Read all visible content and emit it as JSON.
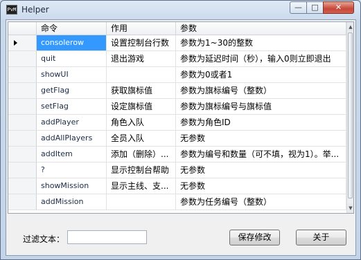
{
  "window": {
    "title": "Helper",
    "app_icon_text": "PvM"
  },
  "grid": {
    "headers": [
      "命令",
      "作用",
      "参数"
    ],
    "rows": [
      {
        "command": "consolerow",
        "effect": "设置控制台行数",
        "params": "参数为1~30的整数"
      },
      {
        "command": "quit",
        "effect": "退出游戏",
        "params": "参数为延迟时间（秒），输入0则立即退出"
      },
      {
        "command": "showUI",
        "effect": "",
        "params": "参数为0或者1"
      },
      {
        "command": "getFlag",
        "effect": "获取旗标值",
        "params": "参数为旗标编号（整数）"
      },
      {
        "command": "setFlag",
        "effect": "设定旗标值",
        "params": "参数为旗标编号与旗标值"
      },
      {
        "command": "addPlayer",
        "effect": "角色入队",
        "params": "参数为角色ID"
      },
      {
        "command": "addAllPlayers",
        "effect": "全员入队",
        "params": "无参数"
      },
      {
        "command": "addItem",
        "effect": "添加（删除）...",
        "params": "参数为编号和数量（可不填，视为1）。举..."
      },
      {
        "command": "?",
        "effect": "显示控制台帮助",
        "params": "无参数"
      },
      {
        "command": "showMission",
        "effect": "显示主线、支...",
        "params": "无参数"
      },
      {
        "command": "addMission",
        "effect": "",
        "params": "参数为任务编号（整数）"
      }
    ]
  },
  "filter": {
    "label": "过滤文本：",
    "value": ""
  },
  "buttons": {
    "save": "保存修改",
    "about": "关于"
  }
}
